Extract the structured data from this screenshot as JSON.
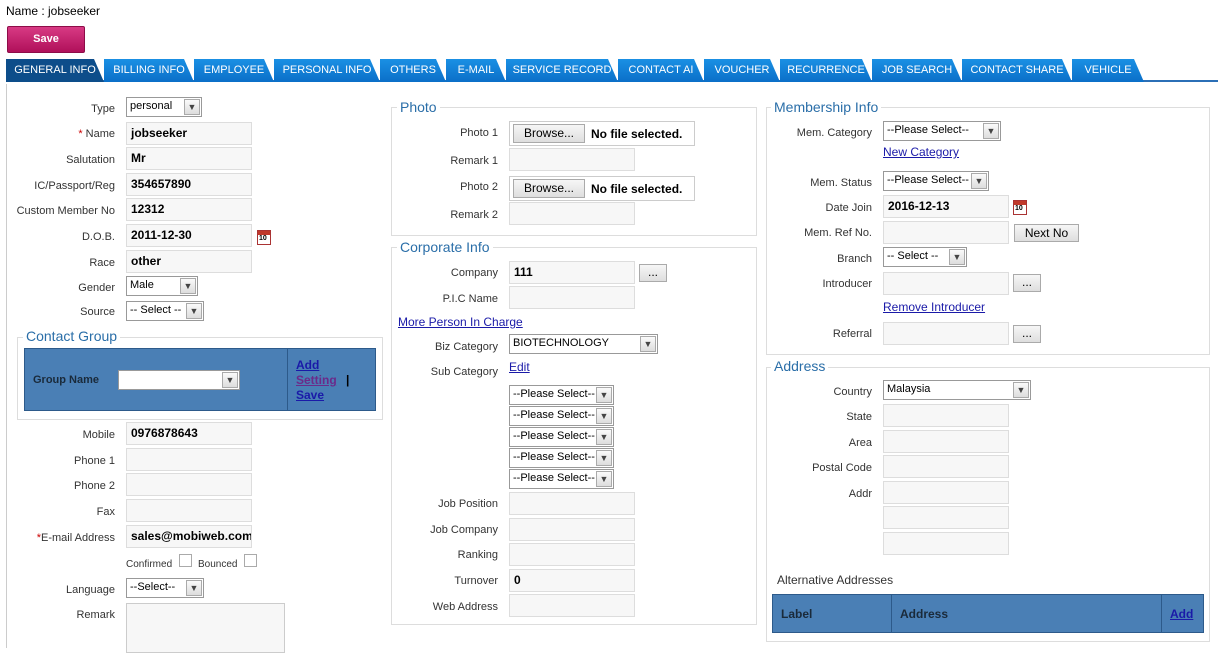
{
  "header": {
    "name_label": "Name : jobseeker",
    "save_label": "Save"
  },
  "tabs": [
    "GENERAL INFO",
    "BILLING INFO",
    "EMPLOYEE",
    "PERSONAL INFO",
    "OTHERS",
    "E-MAIL",
    "SERVICE RECORD",
    "CONTACT AI",
    "VOUCHER",
    "RECURRENCE",
    "JOB SEARCH",
    "CONTACT SHARE",
    "VEHICLE"
  ],
  "general": {
    "type_label": "Type",
    "type_value": "personal",
    "name_label": "Name",
    "name_value": "jobseeker",
    "salutation_label": "Salutation",
    "salutation_value": "Mr",
    "ic_label": "IC/Passport/Reg",
    "ic_value": "354657890",
    "member_label": "Custom Member No",
    "member_value": "12312",
    "dob_label": "D.O.B.",
    "dob_value": "2011-12-30",
    "race_label": "Race",
    "race_value": "other",
    "gender_label": "Gender",
    "gender_value": "Male",
    "source_label": "Source",
    "source_value": "-- Select --"
  },
  "contact_group": {
    "legend": "Contact Group",
    "group_name_label": "Group Name",
    "add": "Add",
    "setting": "Setting",
    "sep": "|",
    "save": "Save"
  },
  "contact": {
    "mobile_label": "Mobile",
    "mobile_value": "0976878643",
    "phone1_label": "Phone 1",
    "phone2_label": "Phone 2",
    "fax_label": "Fax",
    "email_label": "E-mail Address",
    "email_value": "sales@mobiweb.com",
    "confirmed_label": "Confirmed",
    "bounced_label": "Bounced",
    "language_label": "Language",
    "language_value": "--Select--",
    "remark_label": "Remark"
  },
  "photo": {
    "legend": "Photo",
    "photo1_label": "Photo 1",
    "remark1_label": "Remark 1",
    "photo2_label": "Photo 2",
    "remark2_label": "Remark 2",
    "browse": "Browse...",
    "no_file": "No file selected."
  },
  "corporate": {
    "legend": "Corporate Info",
    "company_label": "Company",
    "company_value": "111",
    "ellipsis": "...",
    "pic_label": "P.I.C Name",
    "more_pic": "More Person In Charge",
    "biz_label": "Biz Category",
    "biz_value": "BIOTECHNOLOGY",
    "sub_label": "Sub Category",
    "edit": "Edit",
    "please_select": "--Please Select--",
    "job_position_label": "Job Position",
    "job_company_label": "Job Company",
    "ranking_label": "Ranking",
    "turnover_label": "Turnover",
    "turnover_value": "0",
    "web_label": "Web Address"
  },
  "membership": {
    "legend": "Membership Info",
    "category_label": "Mem. Category",
    "category_value": "--Please Select--",
    "new_category": "New Category",
    "status_label": "Mem. Status",
    "status_value": "--Please Select--",
    "date_join_label": "Date Join",
    "date_join_value": "2016-12-13",
    "ref_label": "Mem. Ref No.",
    "next_no": "Next No",
    "branch_label": "Branch",
    "branch_value": "-- Select --",
    "introducer_label": "Introducer",
    "remove_introducer": "Remove Introducer",
    "referral_label": "Referral",
    "ellipsis": "..."
  },
  "address": {
    "legend": "Address",
    "country_label": "Country",
    "country_value": "Malaysia",
    "state_label": "State",
    "area_label": "Area",
    "postal_label": "Postal Code",
    "addr_label": "Addr",
    "alt_label": "Alternative Addresses",
    "table": {
      "col_label": "Label",
      "col_address": "Address",
      "add": "Add"
    }
  },
  "calendar_day": "10",
  "colors": {
    "tab_blue": "#0b6fc8",
    "tab_active": "#0d4d8a",
    "save_btn": "#c41a6a",
    "legend": "#2a6ea8",
    "header_table": "#4a7fb5"
  }
}
